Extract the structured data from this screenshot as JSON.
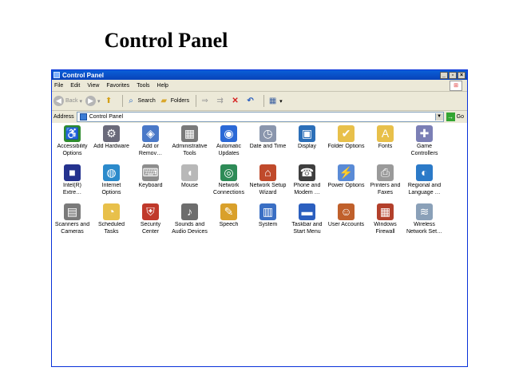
{
  "slide_title": "Control Panel",
  "window": {
    "title": "Control Panel",
    "controls": {
      "minimize": "_",
      "maximize": "▫",
      "close": "×"
    }
  },
  "menu": [
    "File",
    "Edit",
    "View",
    "Favorites",
    "Tools",
    "Help"
  ],
  "toolbar": {
    "back": "Back",
    "search": "Search",
    "folders": "Folders"
  },
  "address": {
    "label": "Address",
    "value": "Control Panel",
    "go": "Go"
  },
  "items": [
    {
      "label": "Accessibility Options",
      "icon": "accessibility-icon",
      "color": "#2e8b2e",
      "glyph": "♿"
    },
    {
      "label": "Add Hardware",
      "icon": "add-hardware-icon",
      "color": "#6a6a7a",
      "glyph": "⚙"
    },
    {
      "label": "Add or Remov…",
      "icon": "add-remove-programs-icon",
      "color": "#4a79c8",
      "glyph": "◈"
    },
    {
      "label": "Administrative Tools",
      "icon": "administrative-tools-icon",
      "color": "#7a7a7a",
      "glyph": "▦"
    },
    {
      "label": "Automatic Updates",
      "icon": "automatic-updates-icon",
      "color": "#2b69d6",
      "glyph": "◉"
    },
    {
      "label": "Date and Time",
      "icon": "date-time-icon",
      "color": "#8a96ad",
      "glyph": "◷"
    },
    {
      "label": "Display",
      "icon": "display-icon",
      "color": "#2c6fb8",
      "glyph": "▣"
    },
    {
      "label": "Folder Options",
      "icon": "folder-options-icon",
      "color": "#e8c04a",
      "glyph": "✔"
    },
    {
      "label": "Fonts",
      "icon": "fonts-icon",
      "color": "#e8c04a",
      "glyph": "A"
    },
    {
      "label": "Game Controllers",
      "icon": "game-controllers-icon",
      "color": "#7b7fb5",
      "glyph": "✚"
    },
    {
      "label": "Intel(R) Extre…",
      "icon": "intel-graphics-icon",
      "color": "#24328e",
      "glyph": "■"
    },
    {
      "label": "Internet Options",
      "icon": "internet-options-icon",
      "color": "#2b8acb",
      "glyph": "◍"
    },
    {
      "label": "Keyboard",
      "icon": "keyboard-icon",
      "color": "#8d8d8d",
      "glyph": "⌨"
    },
    {
      "label": "Mouse",
      "icon": "mouse-icon",
      "color": "#b8b8b8",
      "glyph": "◖"
    },
    {
      "label": "Network Connections",
      "icon": "network-connections-icon",
      "color": "#2e8b57",
      "glyph": "◎"
    },
    {
      "label": "Network Setup Wizard",
      "icon": "network-setup-wizard-icon",
      "color": "#c04a2b",
      "glyph": "⌂"
    },
    {
      "label": "Phone and Modem …",
      "icon": "phone-modem-icon",
      "color": "#3e3e3e",
      "glyph": "☎"
    },
    {
      "label": "Power Options",
      "icon": "power-options-icon",
      "color": "#5a8bd6",
      "glyph": "⚡"
    },
    {
      "label": "Printers and Faxes",
      "icon": "printers-faxes-icon",
      "color": "#9a9a9a",
      "glyph": "⎙"
    },
    {
      "label": "Regional and Language …",
      "icon": "regional-language-icon",
      "color": "#2b7ac8",
      "glyph": "◐"
    },
    {
      "label": "Scanners and Cameras",
      "icon": "scanners-cameras-icon",
      "color": "#7a7a7a",
      "glyph": "▤"
    },
    {
      "label": "Scheduled Tasks",
      "icon": "scheduled-tasks-icon",
      "color": "#e8c04a",
      "glyph": "◔"
    },
    {
      "label": "Security Center",
      "icon": "security-center-icon",
      "color": "#c0392b",
      "glyph": "⛨"
    },
    {
      "label": "Sounds and Audio Devices",
      "icon": "sounds-audio-icon",
      "color": "#6d6d6d",
      "glyph": "♪"
    },
    {
      "label": "Speech",
      "icon": "speech-icon",
      "color": "#d9a02b",
      "glyph": "✎"
    },
    {
      "label": "System",
      "icon": "system-icon",
      "color": "#3a6fc4",
      "glyph": "▥"
    },
    {
      "label": "Taskbar and Start Menu",
      "icon": "taskbar-start-menu-icon",
      "color": "#2b5fbf",
      "glyph": "▬"
    },
    {
      "label": "User Accounts",
      "icon": "user-accounts-icon",
      "color": "#c0602b",
      "glyph": "☺"
    },
    {
      "label": "Windows Firewall",
      "icon": "windows-firewall-icon",
      "color": "#b3402b",
      "glyph": "▦"
    },
    {
      "label": "Wireless Network Set…",
      "icon": "wireless-network-icon",
      "color": "#8aa0b8",
      "glyph": "≋"
    }
  ]
}
